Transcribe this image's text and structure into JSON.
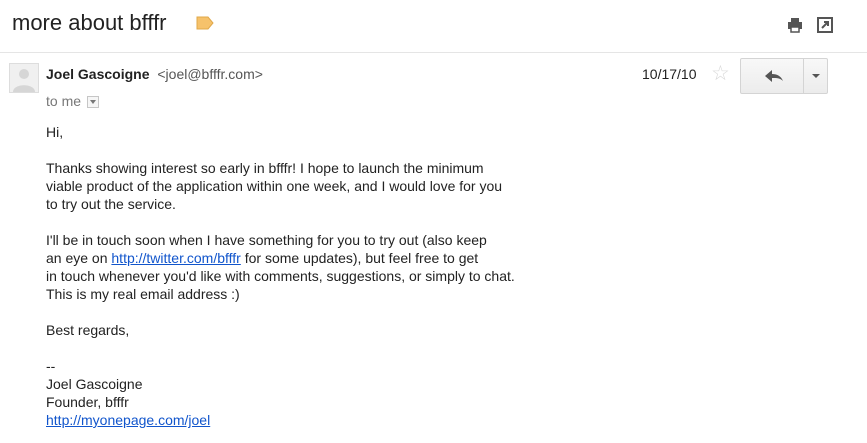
{
  "header": {
    "subject": "more about bfffr"
  },
  "message": {
    "sender_name": "Joel Gascoigne",
    "sender_email": "<joel@bfffr.com>",
    "recipient": "to me",
    "date": "10/17/10",
    "greeting": "Hi,",
    "para1": [
      "Thanks showing interest so early in bfffr! I hope to launch the minimum",
      "viable product of the application within one week, and I would love for you",
      "to try out the service."
    ],
    "para2_line1": "I'll be in touch soon when I have something for you to try out (also keep",
    "para2_line2_prefix": "an eye on ",
    "para2_link": "http://twitter.com/bfffr",
    "para2_line2_suffix": " for some updates), but feel free to get",
    "para2_line3": "in touch whenever you'd like with comments, suggestions, or simply to chat.",
    "para2_line4": "This is my real email address :)",
    "closing": "Best regards,",
    "sig_dash": "--",
    "sig_name": "Joel Gascoigne",
    "sig_title": "Founder, bfffr",
    "sig_link": "http://myonepage.com/joel"
  },
  "icons": {
    "label": "label-tag-icon",
    "print": "print-icon",
    "popout": "new-window-icon",
    "star": "star-icon",
    "reply": "reply-icon",
    "more": "dropdown-arrow-icon"
  },
  "colors": {
    "link": "#1155cc",
    "label_tag": "#f6c26b"
  }
}
